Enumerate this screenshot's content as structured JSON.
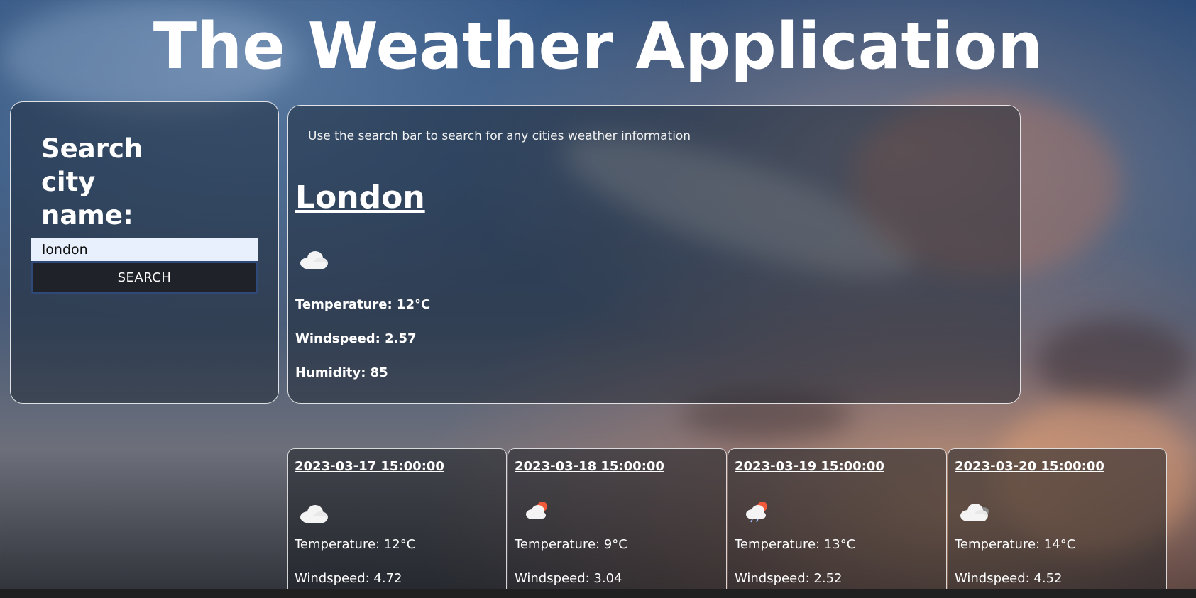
{
  "app": {
    "title": "The Weather Application"
  },
  "search": {
    "label": "Search city name:",
    "input_value": "london",
    "button_label": "SEARCH"
  },
  "current": {
    "hint": "Use the search bar to search for any cities weather information",
    "city": "London",
    "icon": "cloud-icon",
    "temperature": "Temperature: 12°C",
    "windspeed": "Windspeed: 2.57",
    "humidity": "Humidity: 85"
  },
  "forecast": [
    {
      "date": "2023-03-17 15:00:00",
      "icon": "cloud-icon",
      "temperature": "Temperature: 12°C",
      "windspeed": "Windspeed: 4.72"
    },
    {
      "date": "2023-03-18 15:00:00",
      "icon": "cloud-sun-icon",
      "temperature": "Temperature: 9°C",
      "windspeed": "Windspeed: 3.04"
    },
    {
      "date": "2023-03-19 15:00:00",
      "icon": "cloud-sun-rain-icon",
      "temperature": "Temperature: 13°C",
      "windspeed": "Windspeed: 2.52"
    },
    {
      "date": "2023-03-20 15:00:00",
      "icon": "cloud-icon",
      "temperature": "Temperature: 14°C",
      "windspeed": "Windspeed: 4.52"
    }
  ],
  "colors": {
    "panel_border": "#ffffff",
    "button_bg": "#1f2228",
    "button_border": "#2f4a78",
    "input_bg": "#e8f0fe",
    "sun_accent": "#f05a3a"
  }
}
